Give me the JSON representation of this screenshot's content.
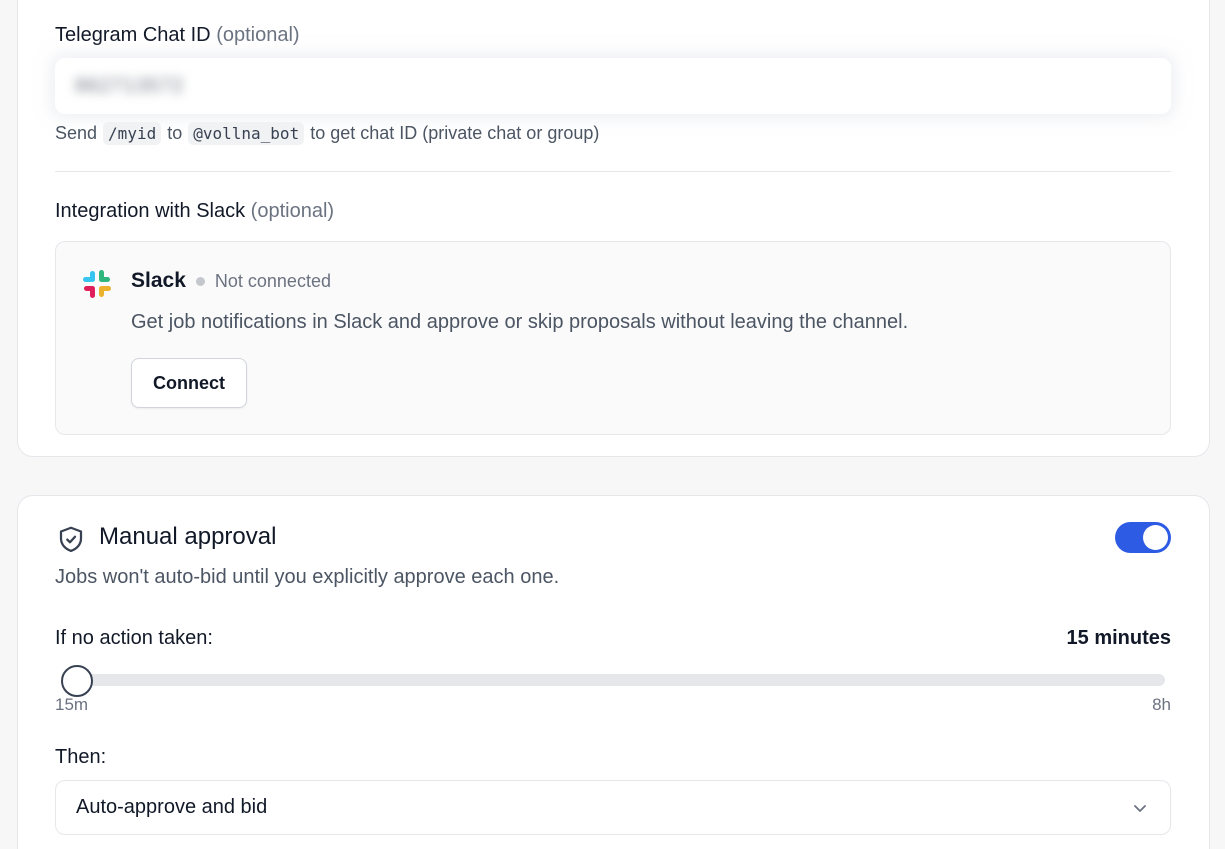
{
  "telegram": {
    "label": "Telegram Chat ID",
    "optional": "(optional)",
    "value": "862713572",
    "helper_send": "Send",
    "helper_cmd": "/myid",
    "helper_to": "to",
    "helper_bot": "@vollna_bot",
    "helper_rest": "to get chat ID (private chat or group)"
  },
  "slack": {
    "label": "Integration with Slack",
    "optional": "(optional)",
    "name": "Slack",
    "status": "Not connected",
    "description": "Get job notifications in Slack and approve or skip proposals without leaving the channel.",
    "connect_label": "Connect",
    "icon": "slack-logo"
  },
  "manual_approval": {
    "title": "Manual approval",
    "icon": "shield-check-icon",
    "description": "Jobs won't auto-bid until you explicitly approve each one.",
    "enabled": true,
    "timeout_label": "If no action taken:",
    "timeout_value": "15 minutes",
    "slider_min": "15m",
    "slider_max": "8h",
    "slider_level": 0,
    "then_label": "Then:",
    "then_value": "Auto-approve and bid"
  },
  "colors": {
    "accent": "#2d5be3",
    "muted_text": "#6b7280"
  }
}
